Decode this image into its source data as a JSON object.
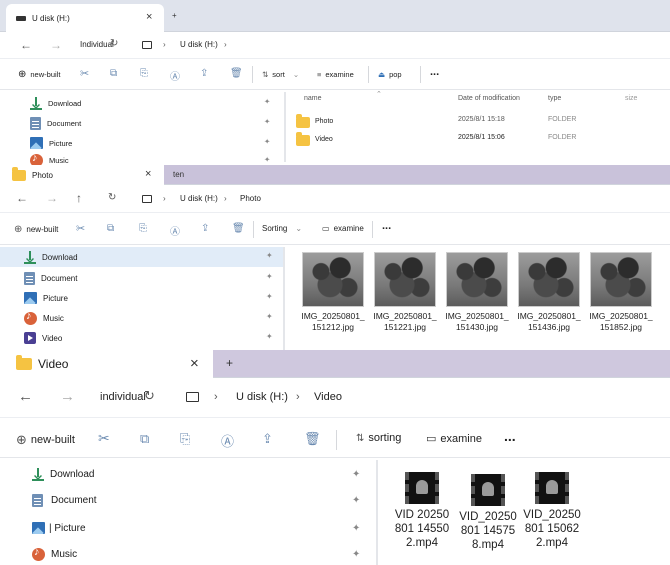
{
  "windows": [
    {
      "tab_title": "U disk (H:)",
      "close": "×",
      "new_tab": "+",
      "address": [
        "Individual",
        "U disk (H:)"
      ],
      "toolbar": {
        "new": "new-built",
        "sort": "sort",
        "view": "examine",
        "pop": "pop",
        "more": "..."
      },
      "sidebar": [
        {
          "label": "Download",
          "icon": "download-icon"
        },
        {
          "label": "Document",
          "icon": "document-icon"
        },
        {
          "label": "Picture",
          "icon": "picture-icon"
        },
        {
          "label": "Music",
          "icon": "music-icon"
        }
      ],
      "columns": {
        "name": "name",
        "date": "Date of modification",
        "type": "type",
        "size": "size"
      },
      "rows": [
        {
          "name": "Photo",
          "date": "2025/8/1 15:18",
          "type": "FOLDER"
        },
        {
          "name": "Video",
          "date": "2025/8/1 15:06",
          "type": "FOLDER"
        }
      ]
    },
    {
      "tab_title": "Photo",
      "close": "×",
      "tab2": "ten",
      "address": [
        "U disk (H:)",
        "Photo"
      ],
      "toolbar": {
        "new": "new-built",
        "sort": "Sorting",
        "view": "examine",
        "more": "..."
      },
      "sidebar": [
        {
          "label": "Download",
          "icon": "download-icon"
        },
        {
          "label": "Document",
          "icon": "document-icon"
        },
        {
          "label": "Picture",
          "icon": "picture-icon"
        },
        {
          "label": "Music",
          "icon": "music-icon"
        },
        {
          "label": "Video",
          "icon": "video-icon"
        }
      ],
      "photos": [
        {
          "line1": "IMG_20250801_",
          "line2": "151212.jpg"
        },
        {
          "line1": "IMG_20250801_",
          "line2": "151221.jpg"
        },
        {
          "line1": "IMG_20250801_",
          "line2": "151430.jpg"
        },
        {
          "line1": "IMG_20250801_",
          "line2": "151436.jpg"
        },
        {
          "line1": "IMG_20250801_",
          "line2": "151852.jpg"
        }
      ]
    },
    {
      "tab_title": "Video",
      "close": "×",
      "new_tab": "+",
      "address": [
        "individual",
        "U disk (H:)",
        "Video"
      ],
      "toolbar": {
        "new": "new-built",
        "sort": "sorting",
        "view": "examine",
        "more": "..."
      },
      "sidebar": [
        {
          "label": "Download",
          "icon": "download-icon"
        },
        {
          "label": "Document",
          "icon": "document-icon"
        },
        {
          "label": "| Picture",
          "icon": "picture-icon"
        },
        {
          "label": "Music",
          "icon": "music-icon"
        }
      ],
      "videos": [
        {
          "line1": "VID 20250",
          "line2": "801 14550",
          "line3": "2.mp4"
        },
        {
          "line1": "VID_20250",
          "line2": "801 14575",
          "line3": "8.mp4"
        },
        {
          "line1": "VID_20250",
          "line2": "801 15062",
          "line3": "2.mp4"
        }
      ]
    }
  ]
}
